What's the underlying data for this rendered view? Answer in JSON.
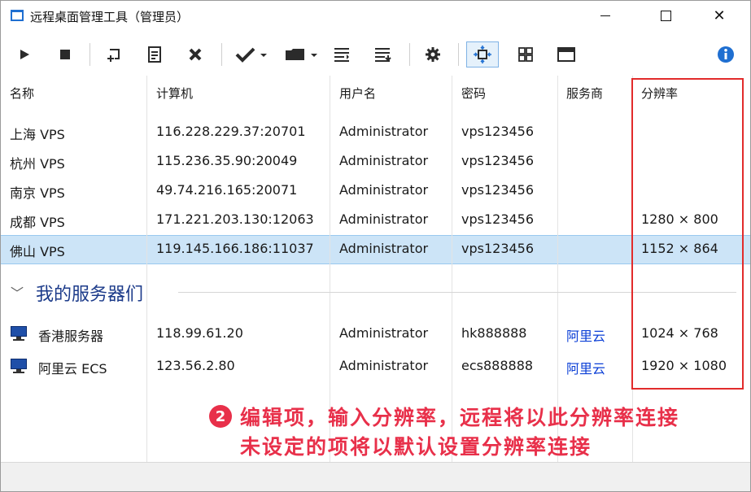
{
  "window": {
    "title": "远程桌面管理工具（管理员）"
  },
  "columns": [
    "名称",
    "计算机",
    "用户名",
    "密码",
    "服务商",
    "分辨率"
  ],
  "rows": [
    {
      "name": "上海 VPS",
      "computer": "116.228.229.37:20701",
      "user": "Administrator",
      "password": "vps123456",
      "provider": "",
      "resolution": ""
    },
    {
      "name": "杭州 VPS",
      "computer": "115.236.35.90:20049",
      "user": "Administrator",
      "password": "vps123456",
      "provider": "",
      "resolution": ""
    },
    {
      "name": "南京 VPS",
      "computer": "49.74.216.165:20071",
      "user": "Administrator",
      "password": "vps123456",
      "provider": "",
      "resolution": ""
    },
    {
      "name": "成都 VPS",
      "computer": "171.221.203.130:12063",
      "user": "Administrator",
      "password": "vps123456",
      "provider": "",
      "resolution": "1280 × 800"
    },
    {
      "name": "佛山 VPS",
      "computer": "119.145.166.186:11037",
      "user": "Administrator",
      "password": "vps123456",
      "provider": "",
      "resolution": "1152 × 864"
    }
  ],
  "group": {
    "title": "我的服务器们",
    "rows": [
      {
        "name": "香港服务器",
        "computer": "118.99.61.20",
        "user": "Administrator",
        "password": "hk888888",
        "provider": "阿里云",
        "resolution": "1024 × 768"
      },
      {
        "name": "阿里云 ECS",
        "computer": "123.56.2.80",
        "user": "Administrator",
        "password": "ecs888888",
        "provider": "阿里云",
        "resolution": "1920 × 1080"
      }
    ]
  },
  "annotation": {
    "badge": "2",
    "line1": "编辑项，输入分辨率，远程将以此分辨率连接",
    "line2": "未设定的项将以默认设置分辨率连接"
  },
  "colors": {
    "accent": "#1f6fd1",
    "selection": "#cce4f7",
    "highlight_border": "#e22b2b",
    "annotation": "#e8304a",
    "group_title": "#1c3b8a",
    "provider_link": "#0b3fd6"
  },
  "icons": [
    "play-icon",
    "stop-icon",
    "new-connection-icon",
    "edit-icon",
    "delete-icon",
    "check-dropdown-icon",
    "folder-dropdown-icon",
    "align-icon",
    "align-alt-icon",
    "settings-icon",
    "fit-window-icon",
    "grid-view-icon",
    "fullscreen-icon",
    "info-icon"
  ]
}
